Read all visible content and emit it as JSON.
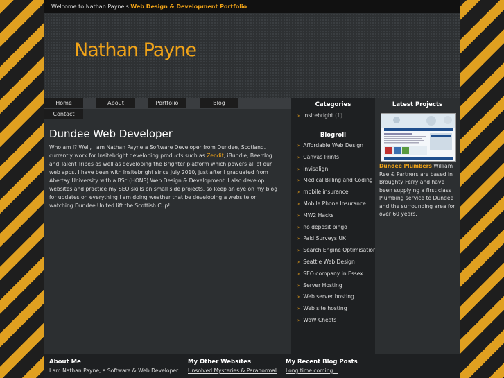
{
  "topbar": {
    "prefix": "Welcome to Nathan Payne's",
    "highlight": "Web Design & Development Portfolio"
  },
  "header": {
    "logo": "Nathan Payne"
  },
  "nav": {
    "items": [
      "Home",
      "About",
      "Portfolio",
      "Blog",
      "Contact"
    ]
  },
  "main": {
    "title": "Dundee Web Developer",
    "p1": "Who am I? Well, I am Nathan Payne a Software Developer from Dundee, Scotland. I currently work for Insitebright developing products such as ",
    "link": "Zendit",
    "p2": ", iBundle, Beerdog and Talent Tribes as well as developing the Brighter platform which powers all of our web apps. I have been with Insitebright since July 2010, just after I graduated from Abertay University with a BSc (HONS) Web Design & Development. I also develop websites and practice my SEO skills on small side projects, so keep an eye on my blog for updates on everything I am doing weather that be developing a website or watching Dundee United lift the Scottish Cup!"
  },
  "categories": {
    "title": "Categories",
    "items": [
      {
        "label": "Insitebright",
        "count": "(1)"
      }
    ]
  },
  "blogroll": {
    "title": "Blogroll",
    "items": [
      "Affordable Web Design",
      "Canvas Prints",
      "invisalign",
      "Medical Billing and Coding",
      "mobile insurance",
      "Mobile Phone Insurance",
      "MW2 Hacks",
      "no deposit bingo",
      "Paid Surveys UK",
      "Search Engine Optimisation",
      "Seattle Web Design",
      "SEO company in Essex",
      "Server Hosting",
      "Web server hosting",
      "Web site hosting",
      "WoW Cheats"
    ]
  },
  "projects": {
    "title": "Latest Projects",
    "name": "Dundee Plumbers",
    "desc": " William Ree & Partners are based in Broughty Ferry and have been supplying a first class Plumbing service to Dundee and the surrounding area for over 60 years."
  },
  "footer": {
    "about_title": "About Me",
    "about_text": "I am Nathan Payne, a Software & Web Developer",
    "sites_title": "My Other Websites",
    "sites_link": "Unsolved Mysteries & Paranormal",
    "blog_title": "My Recent Blog Posts",
    "blog_link": "Long time coming..."
  },
  "colors": {
    "accent": "#f0a318",
    "stripe": "#e0a020",
    "dark": "#1e1e1e"
  }
}
